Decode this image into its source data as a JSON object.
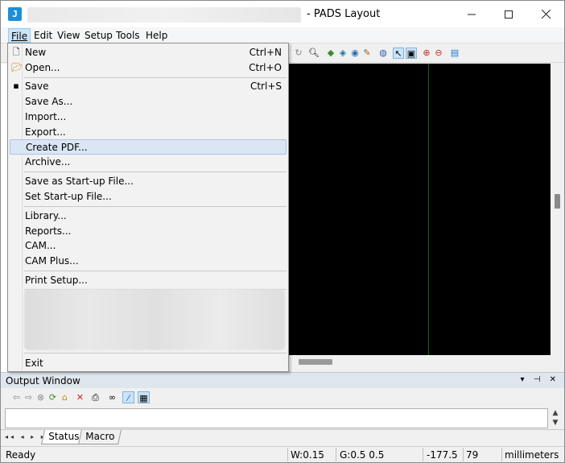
{
  "window": {
    "title": "- PADS Layout",
    "app_icon_glyph": "J"
  },
  "menubar": {
    "items": [
      "File",
      "Edit",
      "View",
      "Setup",
      "Tools",
      "Help"
    ]
  },
  "file_menu": {
    "items": [
      {
        "label": "New",
        "shortcut": "Ctrl+N",
        "icon": "new-document-icon"
      },
      {
        "label": "Open...",
        "shortcut": "Ctrl+O",
        "icon": "open-folder-icon"
      },
      {
        "label": "Save",
        "shortcut": "Ctrl+S",
        "icon": "save-disk-icon"
      },
      {
        "label": "Save As...",
        "shortcut": ""
      },
      {
        "label": "Import...",
        "shortcut": ""
      },
      {
        "label": "Export...",
        "shortcut": ""
      },
      {
        "label": "Create PDF...",
        "shortcut": ""
      },
      {
        "label": "Archive...",
        "shortcut": ""
      },
      {
        "label": "Save as Start-up File...",
        "shortcut": ""
      },
      {
        "label": "Set Start-up File...",
        "shortcut": ""
      },
      {
        "label": "Library...",
        "shortcut": ""
      },
      {
        "label": "Reports...",
        "shortcut": ""
      },
      {
        "label": "CAM...",
        "shortcut": ""
      },
      {
        "label": "CAM Plus...",
        "shortcut": ""
      },
      {
        "label": "Print Setup...",
        "shortcut": ""
      },
      {
        "label": "Exit",
        "shortcut": ""
      }
    ],
    "highlighted": "Create PDF..."
  },
  "output_window": {
    "title": "Output Window",
    "text": ""
  },
  "tabs": [
    {
      "label": "Status"
    },
    {
      "label": "Macro"
    }
  ],
  "status": {
    "state": "Ready",
    "width": "W:0.15",
    "grid": "G:0.5 0.5",
    "x": "-177.5",
    "y": "79",
    "units": "millimeters"
  },
  "colors": {
    "canvas": "#000000",
    "menu_highlight": "#dbe6f4",
    "accent": "#1e8fd6"
  }
}
